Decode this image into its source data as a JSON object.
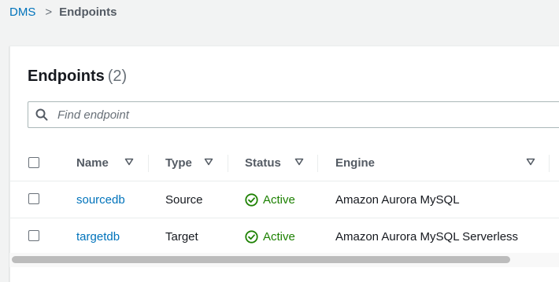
{
  "breadcrumb": {
    "root": "DMS",
    "separator": ">",
    "current": "Endpoints"
  },
  "panel": {
    "title": "Endpoints",
    "count": "(2)"
  },
  "search": {
    "placeholder": "Find endpoint",
    "value": ""
  },
  "table": {
    "columns": [
      "Name",
      "Type",
      "Status",
      "Engine"
    ],
    "rows": [
      {
        "name": "sourcedb",
        "type": "Source",
        "status": "Active",
        "engine": "Amazon Aurora MySQL"
      },
      {
        "name": "targetdb",
        "type": "Target",
        "status": "Active",
        "engine": "Amazon Aurora MySQL Serverless"
      }
    ]
  },
  "colors": {
    "link": "#0073bb",
    "success": "#1d8102",
    "text": "#16191f",
    "muted": "#545b64"
  },
  "icons": [
    "search-icon",
    "sort-caret-icon",
    "check-circle-icon"
  ]
}
